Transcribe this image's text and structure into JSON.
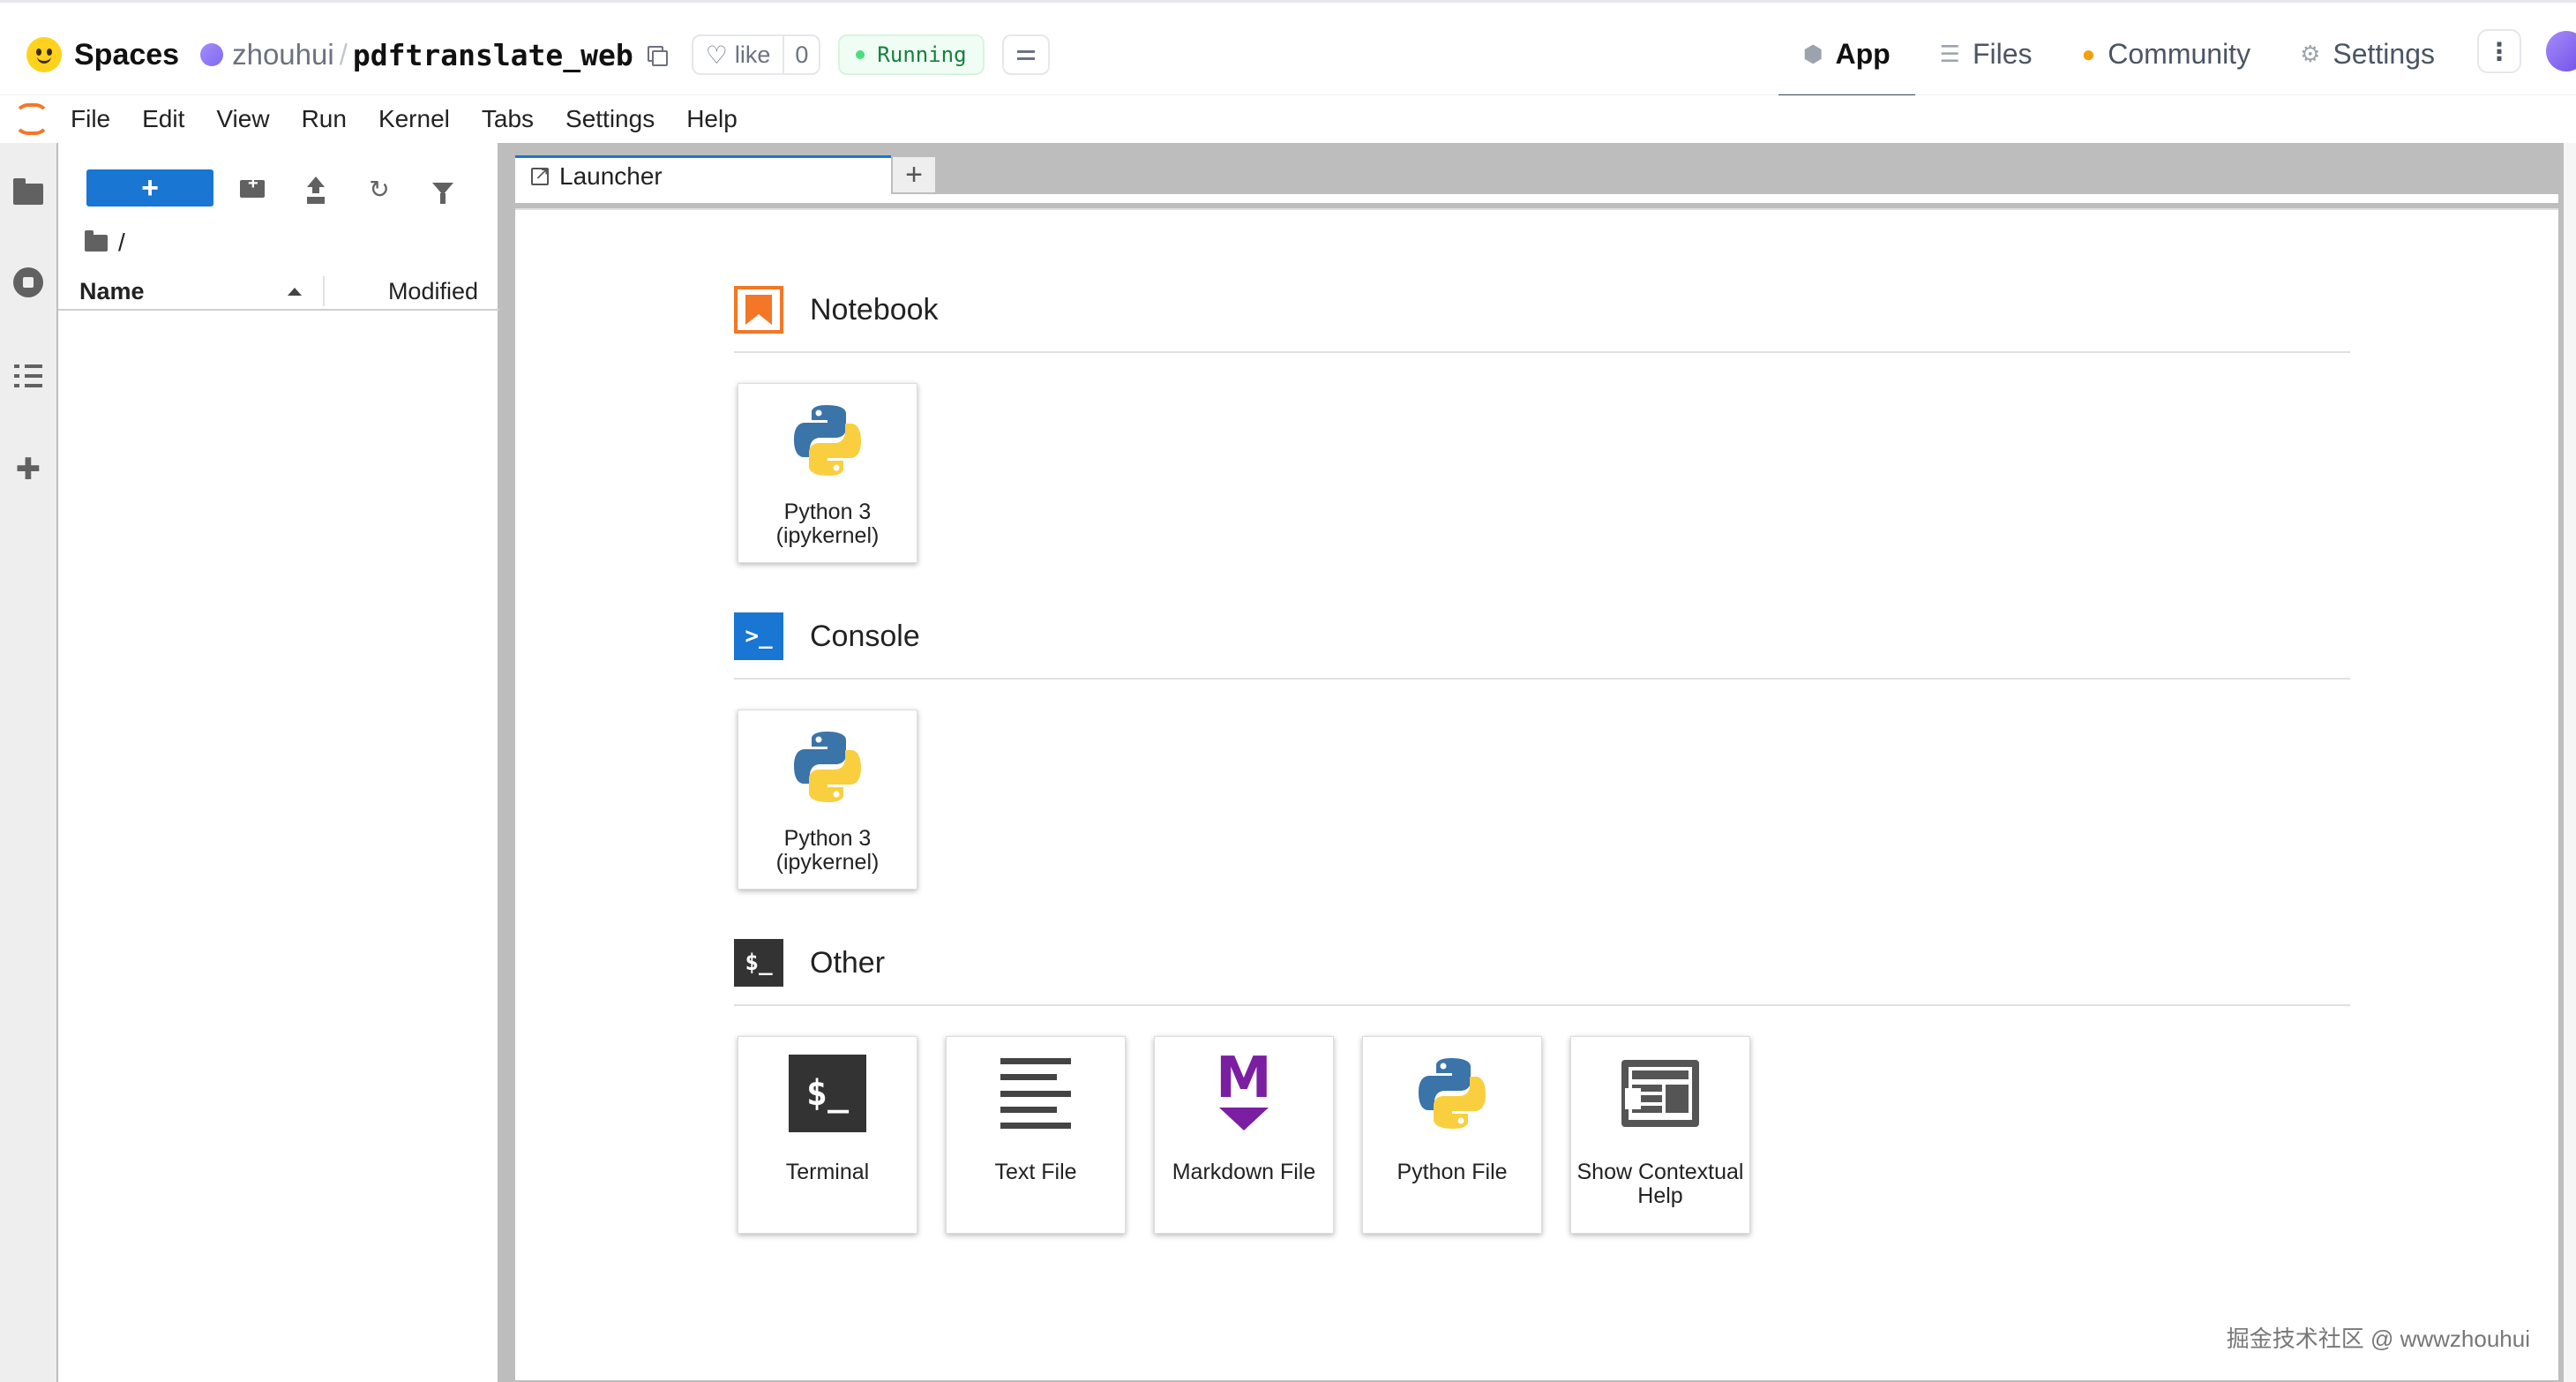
{
  "hf_header": {
    "brand": "Spaces",
    "owner": "zhouhui",
    "separator": "/",
    "repo": "pdftranslate_web",
    "like_label": "like",
    "like_count": "0",
    "status": "Running",
    "tabs": [
      {
        "label": "App",
        "icon": "cube-icon",
        "active": true
      },
      {
        "label": "Files",
        "icon": "files-icon",
        "active": false
      },
      {
        "label": "Community",
        "icon": "community-icon",
        "active": false
      },
      {
        "label": "Settings",
        "icon": "gear-icon",
        "active": false
      }
    ],
    "menu_glyph": "⋮"
  },
  "menubar": {
    "items": [
      "File",
      "Edit",
      "View",
      "Run",
      "Kernel",
      "Tabs",
      "Settings",
      "Help"
    ]
  },
  "file_browser": {
    "new_button_label": "+",
    "breadcrumb": "/",
    "columns": {
      "name": "Name",
      "modified": "Modified"
    }
  },
  "tabs": {
    "active_label": "Launcher",
    "add_label": "+"
  },
  "launcher": {
    "sections": {
      "notebook": {
        "title": "Notebook",
        "cards": [
          {
            "label": "Python 3 (ipykernel)",
            "icon": "python-icon"
          }
        ]
      },
      "console": {
        "title": "Console",
        "icon_text": ">_",
        "cards": [
          {
            "label": "Python 3 (ipykernel)",
            "icon": "python-icon"
          }
        ]
      },
      "other": {
        "title": "Other",
        "icon_text": "$_",
        "cards": [
          {
            "label": "Terminal",
            "icon": "terminal-icon",
            "glyph": "$_"
          },
          {
            "label": "Text File",
            "icon": "text-file-icon"
          },
          {
            "label": "Markdown File",
            "icon": "markdown-icon",
            "glyph": "M"
          },
          {
            "label": "Python File",
            "icon": "python-icon"
          },
          {
            "label": "Show Contextual Help",
            "icon": "contextual-help-icon"
          }
        ]
      }
    }
  },
  "watermark": "掘金技术社区 @ wwwzhouhui",
  "colors": {
    "jupyter_orange": "#f37726",
    "console_blue": "#1976d2",
    "markdown_purple": "#7b1fa2",
    "running_green": "#15803d",
    "python_blue": "#3a74a8",
    "python_yellow": "#f9cf3f"
  }
}
